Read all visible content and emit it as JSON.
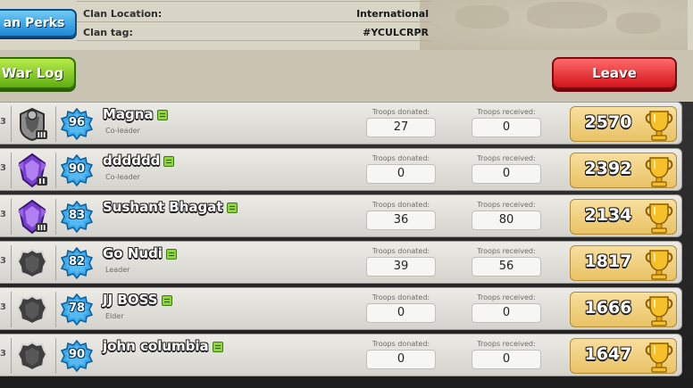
{
  "clan_info": {
    "rows": [
      {
        "key": "Clan Location:",
        "value": "International"
      },
      {
        "key": "Clan tag:",
        "value": "#YCULCRPR"
      }
    ]
  },
  "buttons": {
    "perks": "an Perks",
    "war_log": "War Log",
    "leave": "Leave"
  },
  "stat_labels": {
    "donated": "Troops donated:",
    "received": "Troops received:"
  },
  "members": [
    {
      "level": "96",
      "name": "Magna",
      "role": "Co-leader",
      "donated": "27",
      "received": "0",
      "trophies": "2570",
      "league": "grey-league",
      "rank_tail": "3"
    },
    {
      "level": "90",
      "name": "dddddd",
      "role": "Co-leader",
      "donated": "0",
      "received": "0",
      "trophies": "2392",
      "league": "purple-league-2",
      "rank_tail": "3"
    },
    {
      "level": "83",
      "name": "Sushant Bhagat",
      "role": "",
      "donated": "36",
      "received": "80",
      "trophies": "2134",
      "league": "purple-league-3",
      "rank_tail": "3"
    },
    {
      "level": "82",
      "name": "Go Nudi",
      "role": "Leader",
      "donated": "39",
      "received": "56",
      "trophies": "1817",
      "league": "unranked",
      "rank_tail": "3"
    },
    {
      "level": "78",
      "name": "JJ BOSS",
      "role": "Elder",
      "donated": "0",
      "received": "0",
      "trophies": "1666",
      "league": "unranked",
      "rank_tail": "3"
    },
    {
      "level": "90",
      "name": "john columbia",
      "role": "",
      "donated": "0",
      "received": "0",
      "trophies": "1647",
      "league": "unranked",
      "rank_tail": "3"
    }
  ],
  "colors": {
    "accent_blue": "#1c87d6",
    "war_green": "#5fae12",
    "leave_red": "#d3141a",
    "trophy_gold": "#e9c265",
    "purple_league": "#7b3fd0"
  }
}
